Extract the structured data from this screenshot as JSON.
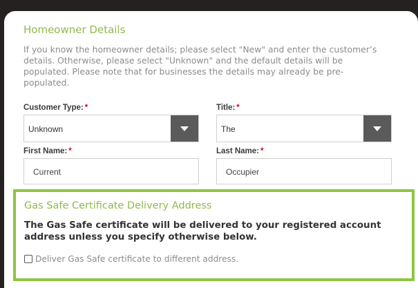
{
  "homeowner": {
    "title": "Homeowner Details",
    "intro": "If you know the homeowner details; please select \"New\" and enter the customer’s details. Otherwise, please select \"Unknown\" and the default details will be populated. Please note that for businesses the details may already be pre-populated.",
    "customer_type": {
      "label": "Customer Type:",
      "required": "*",
      "value": "Unknown"
    },
    "title_field": {
      "label": "Title:",
      "required": "*",
      "value": "The"
    },
    "first_name": {
      "label": "First Name:",
      "required": "*",
      "value": "Current"
    },
    "last_name": {
      "label": "Last Name:",
      "required": "*",
      "value": "Occupier"
    }
  },
  "gas_safe": {
    "title": "Gas Safe Certificate Delivery Address",
    "note": "The Gas Safe certificate will be delivered to your registered account address unless you specify otherwise below.",
    "checkbox_label": "Deliver Gas Safe certificate to different address.",
    "accent": "#8cc63f"
  }
}
